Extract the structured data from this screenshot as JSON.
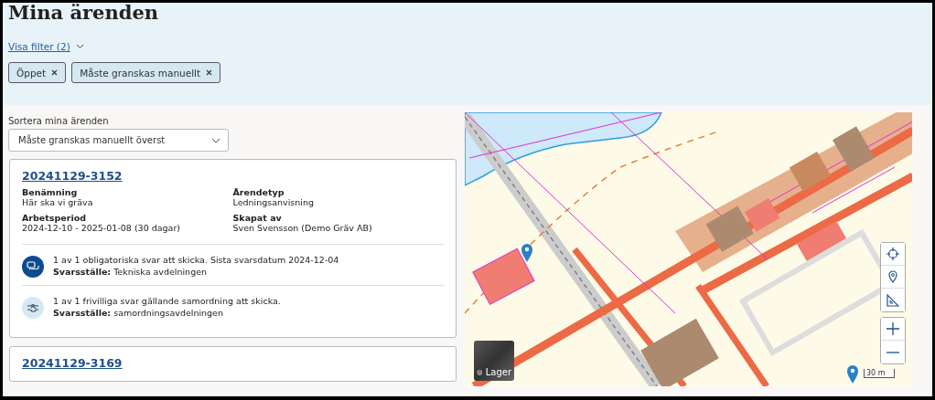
{
  "title": "Mina ärenden",
  "filter_toggle": {
    "label": "Visa filter (2)"
  },
  "filter_chips": [
    {
      "label": "Öppet"
    },
    {
      "label": "Måste granskas manuellt"
    }
  ],
  "sort": {
    "label": "Sortera mina ärenden",
    "value": "Måste granskas manuellt överst"
  },
  "cases": [
    {
      "number": "20241129-3152",
      "fields": [
        {
          "label": "Benämning",
          "value": "Här ska vi gräva"
        },
        {
          "label": "Ärendetyp",
          "value": "Ledningsanvisning"
        },
        {
          "label": "Arbetsperiod",
          "value": "2024-12-10 - 2025-01-08 (30 dagar)"
        },
        {
          "label": "Skapat av",
          "value": "Sven Svensson (Demo Gräv AB)"
        }
      ],
      "notices": [
        {
          "kind": "mandatory",
          "text": "1 av 1 obligatoriska svar att skicka. Sista svarsdatum 2024-12-04",
          "detail": "**Svarsställe:** Tekniska avdelningen"
        },
        {
          "kind": "voluntary",
          "text": "1 av 1 frivilliga svar gällande samordning att skicka.",
          "detail": "**Svarsställe:** samordningsavdelningen"
        }
      ]
    },
    {
      "number": "20241129-3169"
    }
  ],
  "map": {
    "layer_button": "Lager",
    "scale": "30 m"
  }
}
